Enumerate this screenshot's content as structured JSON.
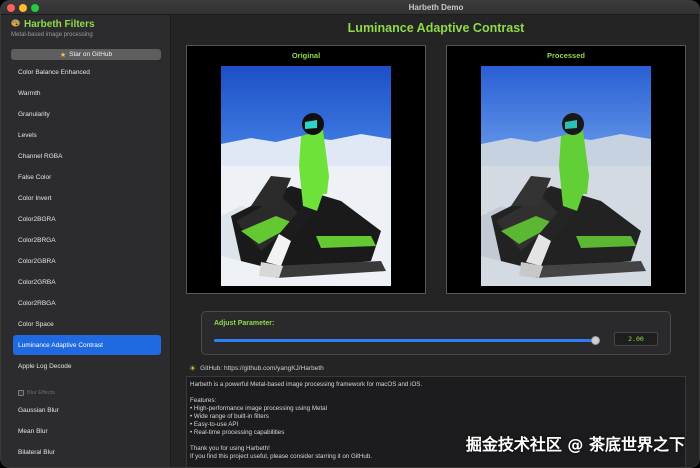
{
  "window": {
    "title": "Harbeth Demo"
  },
  "sidebar": {
    "app_title": "Harbeth Filters",
    "app_subtitle": "Metal-based image processing",
    "star_button_label": "Star on GitHub",
    "filters": [
      "Color Balance Enhanced",
      "Warmth",
      "Granularity",
      "Levels",
      "Channel RGBA",
      "False Color",
      "Color Invert",
      "Color2BGRA",
      "Color2BRGA",
      "Color2GBRA",
      "Color2GRBA",
      "Color2RBGA",
      "Color Space",
      "Luminance Adaptive Contrast",
      "Apple Log Decode"
    ],
    "selected_filter": "Luminance Adaptive Contrast",
    "section_toggle_label": "Blur Effects",
    "section_toggle_checked": false,
    "blur_filters": [
      "Gaussian Blur",
      "Mean Blur",
      "Bilateral Blur"
    ]
  },
  "main": {
    "title": "Luminance Adaptive Contrast",
    "original_label": "Original",
    "processed_label": "Processed",
    "adjust_label": "Adjust Parameter:",
    "slider_fraction": 0.99,
    "value_display": "2.00",
    "github_text": "GitHub: https://github.com/yangKJ/Harbeth",
    "info_lines": [
      "Harbeth is a powerful Metal-based image processing framework for macOS and iOS.",
      "",
      "Features:",
      "• High-performance image processing using Metal",
      "• Wide range of built-in filters",
      "• Easy-to-use API",
      "• Real-time processing capabilities",
      "",
      "Thank you for using Harbeth!",
      "If you find this project useful, please consider starring it on GitHub."
    ]
  },
  "watermark": "掘金技术社区 @ 茶底世界之下",
  "colors": {
    "accent_green": "#8fd94a",
    "selection_blue": "#1f6ae0",
    "slider_blue": "#2f7df2",
    "window_background": "#242424"
  },
  "icons": {
    "app_icon": "palette-icon",
    "star_icon": "star-icon",
    "github_icon": "sun-icon"
  }
}
